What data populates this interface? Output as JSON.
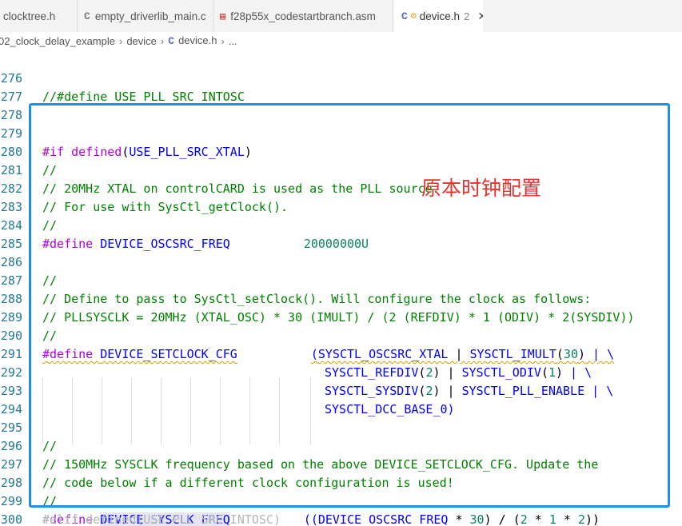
{
  "tabs": [
    {
      "label": "clocktree.h",
      "icon": "c-file-icon",
      "active": false
    },
    {
      "label": "empty_driverlib_main.c",
      "icon": "c-file-icon",
      "active": false
    },
    {
      "label": "f28p55x_codestartbranch.asm",
      "icon": "asm-file-icon",
      "active": false
    },
    {
      "label": "device.h",
      "icon": "c-header-icon",
      "badge": "2",
      "close": "✕",
      "active": true
    }
  ],
  "breadcrumb": {
    "items": [
      "02_clock_delay_example",
      "device",
      "device.h",
      "..."
    ]
  },
  "annotation": "原本时钟配置",
  "lines": {
    "l276": {
      "n": "276",
      "a": "//#define USE_PLL_SRC_INTOSC"
    },
    "l277": {
      "n": "277"
    },
    "l278": {
      "n": "278"
    },
    "l279": {
      "n": "279",
      "a": "#if",
      "b": " defined",
      "c": "(",
      "d": "USE_PLL_SRC_XTAL",
      "e": ")"
    },
    "l280": {
      "n": "280",
      "a": "//"
    },
    "l281": {
      "n": "281",
      "a": "// 20MHz XTAL on controlCARD is used as the PLL source."
    },
    "l282": {
      "n": "282",
      "a": "// For use with SysCtl_getClock()."
    },
    "l283": {
      "n": "283",
      "a": "//"
    },
    "l284": {
      "n": "284",
      "a": "#define",
      "b": "DEVICE_OSCSRC_FREQ",
      "c": "20000000U"
    },
    "l285": {
      "n": "285"
    },
    "l286": {
      "n": "286",
      "a": "//"
    },
    "l287": {
      "n": "287",
      "a": "// Define to pass to SysCtl_setClock(). Will configure the clock as follows:"
    },
    "l288": {
      "n": "288",
      "a": "// PLLSYSCLK = 20MHz (XTAL_OSC) * 30 (IMULT) / (2 (REFDIV) * 1 (ODIV) * 2(SYSDIV))"
    },
    "l289": {
      "n": "289",
      "a": "//"
    },
    "l290": {
      "n": "290",
      "a": "#define",
      "b": "DEVICE_SETCLOCK_CFG",
      "c": "(",
      "d": "SYSCTL_OSCSRC_XTAL",
      "e": " | ",
      "f": "SYSCTL_IMULT",
      "g": "(",
      "h": "30",
      "i": ")",
      "j": " | \\"
    },
    "l291": {
      "n": "291",
      "a": "SYSCTL_REFDIV",
      "b": "(",
      "c": "2",
      "d": ")",
      "e": " | ",
      "f": "SYSCTL_ODIV",
      "g": "(",
      "h": "1",
      "i": ")",
      "j": " | \\"
    },
    "l292": {
      "n": "292",
      "a": "SYSCTL_SYSDIV",
      "b": "(",
      "c": "2",
      "d": ")",
      "e": " | ",
      "f": "SYSCTL_PLL_ENABLE",
      "g": " | \\"
    },
    "l293": {
      "n": "293",
      "a": "SYSCTL_DCC_BASE_0",
      "b": ")"
    },
    "l294": {
      "n": "294"
    },
    "l295": {
      "n": "295",
      "a": "//"
    },
    "l296": {
      "n": "296",
      "a": "// 150MHz SYSCLK frequency based on the above DEVICE_SETCLOCK_CFG. Update the"
    },
    "l297": {
      "n": "297",
      "a": "// code below if a different clock configuration is used!"
    },
    "l298": {
      "n": "298",
      "a": "//"
    },
    "l299": {
      "n": "299",
      "a": "#define",
      "b": "DEVICE_SYSCLK_FREQ",
      "c": "((",
      "d": "DEVICE_OSCSRC_FREQ",
      "e": " * ",
      "f": "30",
      "g": ") / (",
      "h": "2",
      "i": " * ",
      "j": "1",
      "k": " * ",
      "l": "2",
      "m": "))"
    },
    "l300": {
      "n": "300"
    }
  },
  "cutoff_text": "#elif defined(USE_PLL_SRC_INTOSC)"
}
